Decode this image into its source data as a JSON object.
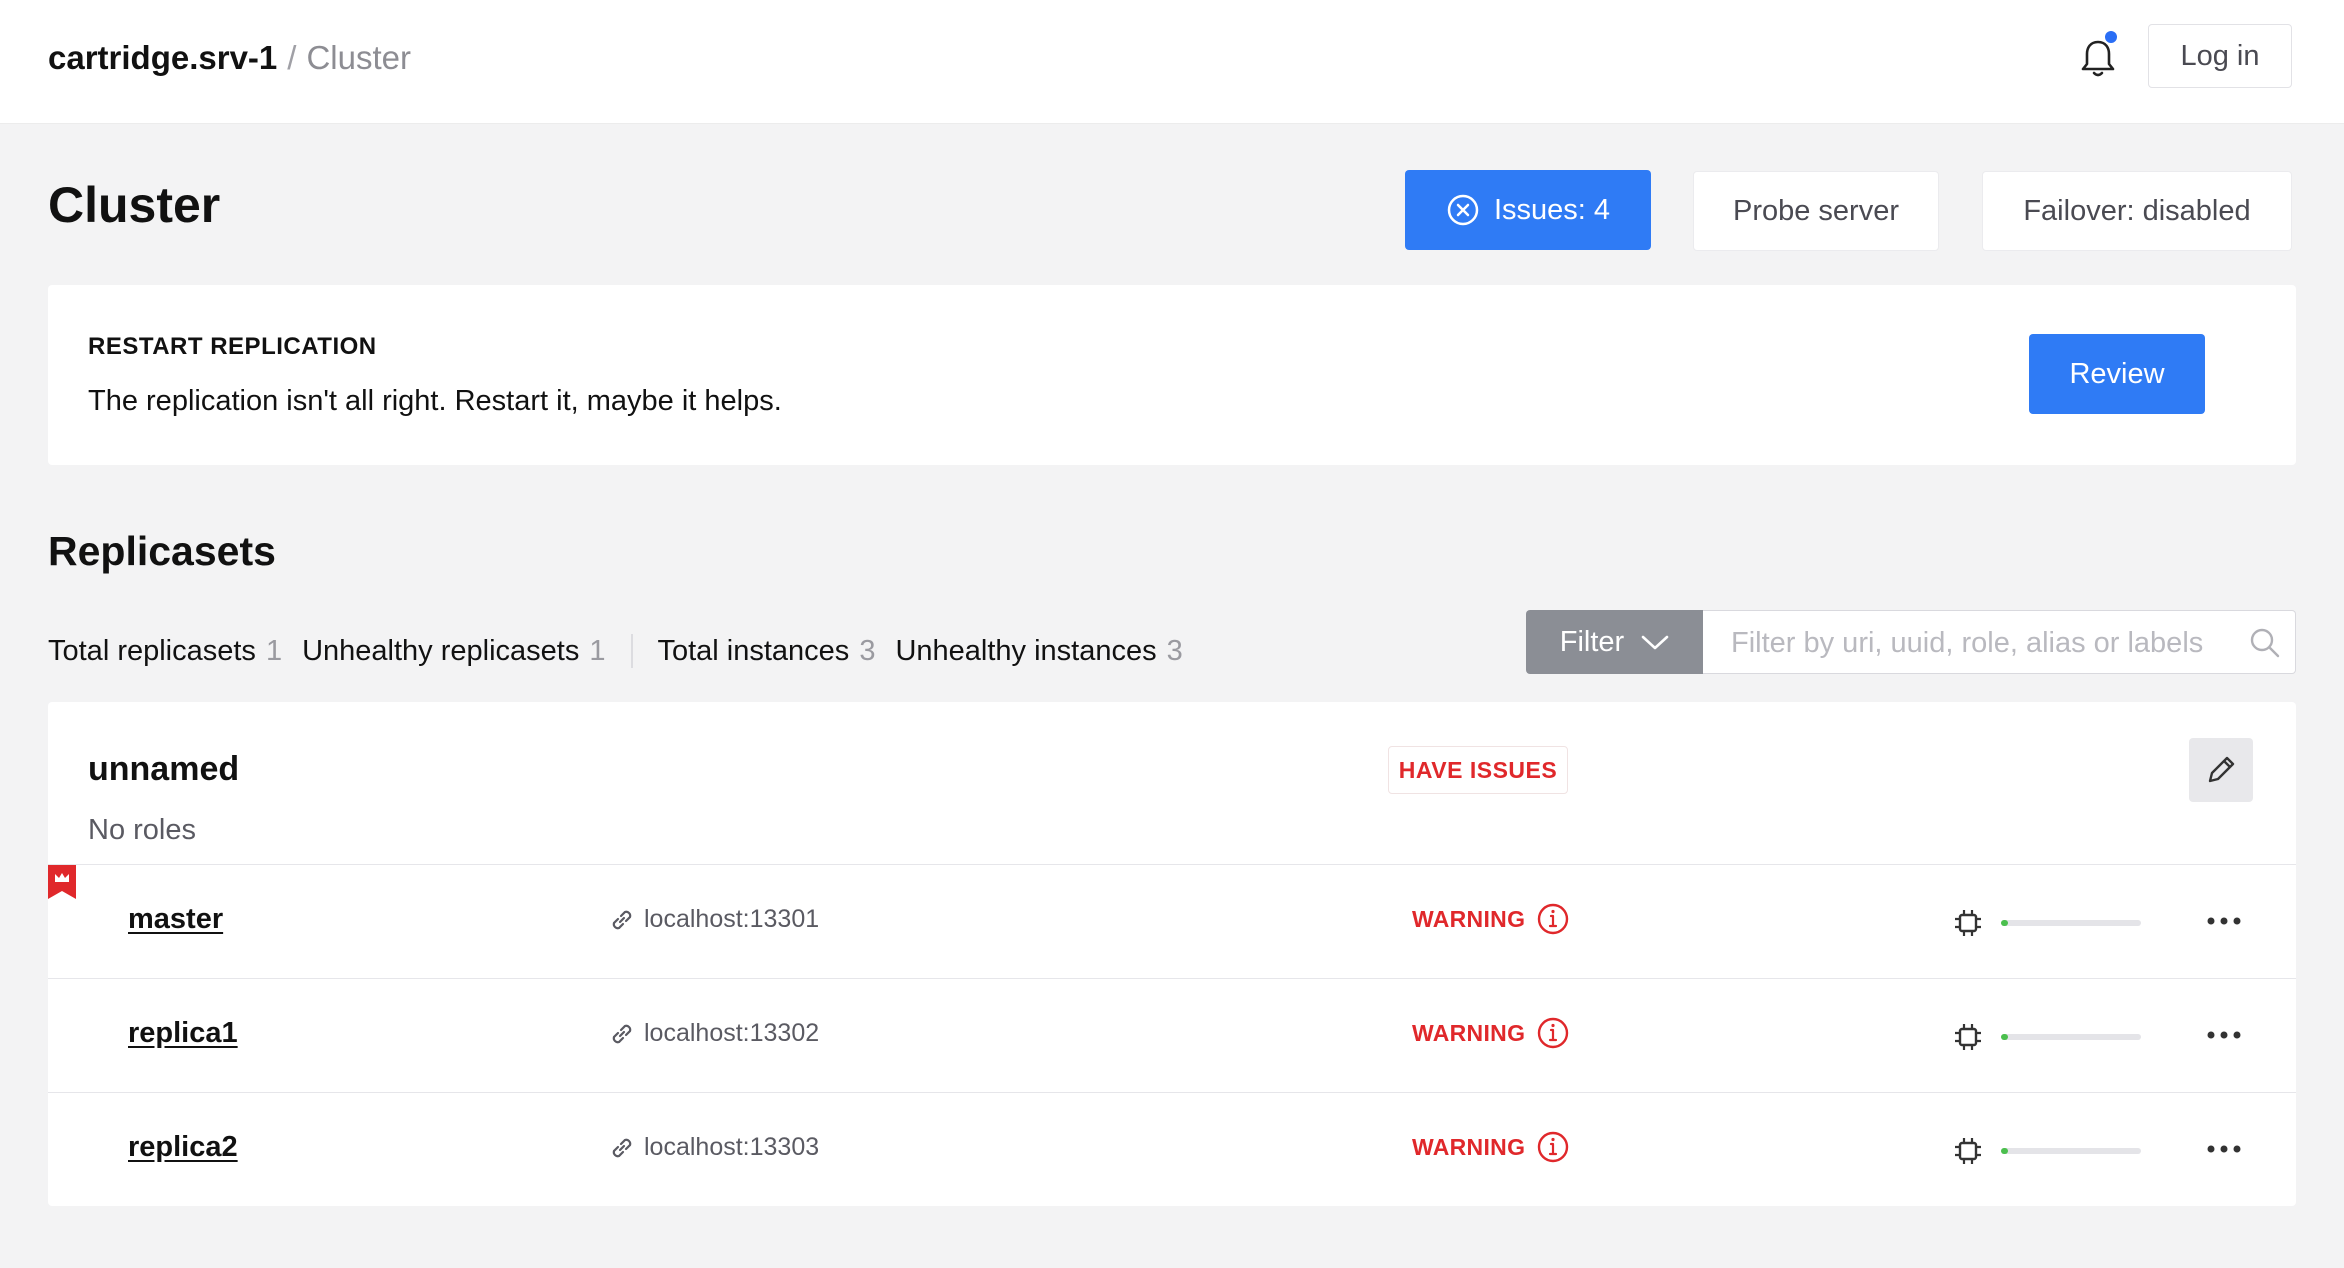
{
  "header": {
    "app_name": "cartridge.srv-1",
    "separator": "/",
    "current_page": "Cluster",
    "login_label": "Log in"
  },
  "page": {
    "title": "Cluster",
    "issues_label": "Issues: 4",
    "probe_label": "Probe server",
    "failover_label": "Failover: disabled"
  },
  "issue_card": {
    "title": "RESTART REPLICATION",
    "description": "The replication isn't all right. Restart it, maybe it helps.",
    "review_label": "Review"
  },
  "replicasets": {
    "title": "Replicasets",
    "stats": {
      "total_replicasets_label": "Total replicasets",
      "total_replicasets": "1",
      "unhealthy_replicasets_label": "Unhealthy replicasets",
      "unhealthy_replicasets": "1",
      "total_instances_label": "Total instances",
      "total_instances": "3",
      "unhealthy_instances_label": "Unhealthy instances",
      "unhealthy_instances": "3"
    },
    "filter_label": "Filter",
    "search_placeholder": "Filter by uri, uuid, role, alias or labels",
    "items": [
      {
        "name": "unnamed",
        "roles": "No roles",
        "badge": "HAVE ISSUES",
        "instances": [
          {
            "name": "master",
            "uri": "localhost:13301",
            "status": "WARNING",
            "memory_usage": 0.05,
            "leader": true
          },
          {
            "name": "replica1",
            "uri": "localhost:13302",
            "status": "WARNING",
            "memory_usage": 0.05,
            "leader": false
          },
          {
            "name": "replica2",
            "uri": "localhost:13303",
            "status": "WARNING",
            "memory_usage": 0.05,
            "leader": false
          }
        ]
      }
    ]
  },
  "colors": {
    "accent": "#2f7bf5",
    "danger": "#e0282b",
    "ok": "#4bbf4e",
    "filter_bg": "#8b8e95"
  },
  "icons": {
    "notification": "bell-icon",
    "issues": "circle-x-icon",
    "filter_caret": "chevron-down-icon",
    "search": "search-icon",
    "edit": "pencil-icon",
    "uri": "link-icon",
    "status": "info-icon",
    "memory": "chip-icon",
    "actions": "more-horizontal-icon",
    "leader": "crown-icon"
  }
}
